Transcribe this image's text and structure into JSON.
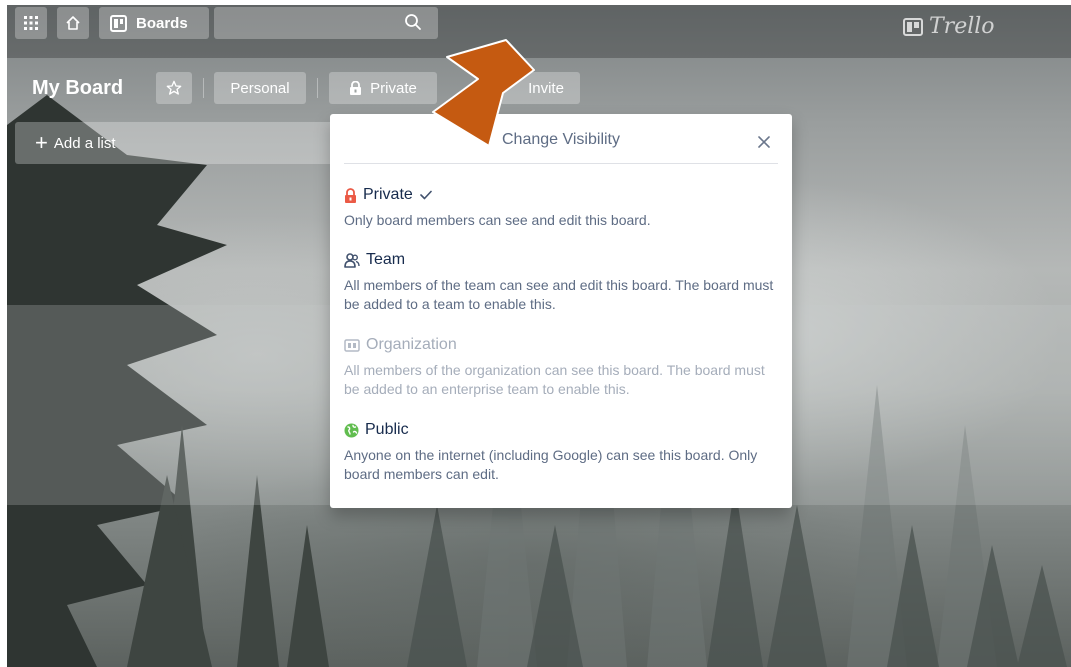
{
  "header": {
    "apps_icon": "grid-icon",
    "home_icon": "home-icon",
    "boards_icon": "board-icon",
    "boards_label": "Boards",
    "search_value": "",
    "search_icon": "search-icon",
    "logo_text": "Trello"
  },
  "board": {
    "title": "My Board",
    "star_icon": "star-icon",
    "personal_label": "Personal",
    "private_label": "Private",
    "invite_label": "Invite",
    "add_list_label": "Add a list"
  },
  "popover": {
    "title": "Change Visibility",
    "close_icon": "close-icon",
    "options": [
      {
        "label": "Private",
        "icon": "lock-icon",
        "selected": true,
        "description": "Only board members can see and edit this board."
      },
      {
        "label": "Team",
        "icon": "team-icon",
        "selected": false,
        "description": "All members of the team can see and edit this board. The board must be added to a team to enable this."
      },
      {
        "label": "Organization",
        "icon": "organization-icon",
        "selected": false,
        "disabled": true,
        "description": "All members of the organization can see this board. The board must be added to an enterprise team to enable this."
      },
      {
        "label": "Public",
        "icon": "globe-icon",
        "selected": false,
        "description": "Anyone on the internet (including Google) can see this board. Only board members can edit."
      }
    ]
  },
  "colors": {
    "private_icon": "#eb5a46",
    "public_icon": "#61bd4f",
    "annotation_arrow": "#c55a11"
  }
}
